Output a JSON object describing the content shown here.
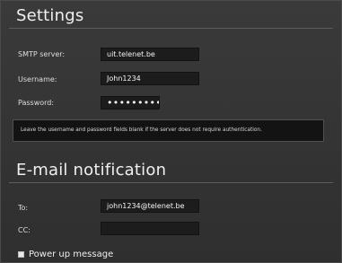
{
  "settings": {
    "title": "Settings",
    "smtp_label": "SMTP server:",
    "smtp_value": "uit.telenet.be",
    "username_label": "Username:",
    "username_value": "John1234",
    "password_label": "Password:",
    "password_value": "•••••••••",
    "info_text": "Leave the username and password fields blank if the server does not require authentication."
  },
  "notification": {
    "title": "E-mail notification",
    "to_label": "To:",
    "to_value": "john1234@telenet.be",
    "cc_label": "CC:",
    "cc_value": "",
    "power_up_label": "Power up message"
  }
}
